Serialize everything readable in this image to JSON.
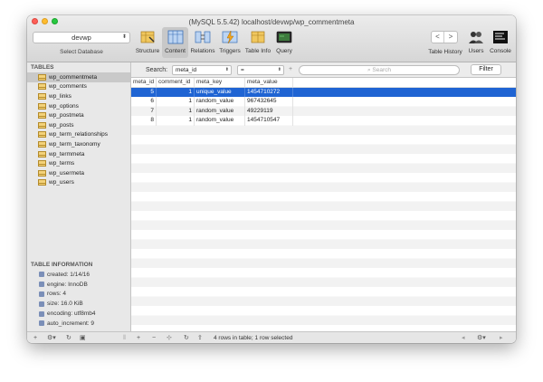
{
  "window": {
    "title": "(MySQL 5.5.42) localhost/devwp/wp_commentmeta"
  },
  "database": {
    "selected": "devwp",
    "label": "Select Database"
  },
  "toolbar": {
    "structure": "Structure",
    "content": "Content",
    "relations": "Relations",
    "triggers": "Triggers",
    "table_info": "Table Info",
    "query": "Query",
    "table_history": "Table History",
    "users": "Users",
    "console": "Console"
  },
  "nav": {
    "back": "<",
    "forward": ">"
  },
  "sidebar": {
    "tables_header": "TABLES",
    "tables": [
      "wp_commentmeta",
      "wp_comments",
      "wp_links",
      "wp_options",
      "wp_postmeta",
      "wp_posts",
      "wp_term_relationships",
      "wp_term_taxonomy",
      "wp_termmeta",
      "wp_terms",
      "wp_usermeta",
      "wp_users"
    ],
    "info_header": "TABLE INFORMATION",
    "info": [
      "created: 1/14/16",
      "engine: InnoDB",
      "rows: 4",
      "size: 16.0 KiB",
      "encoding: utf8mb4",
      "auto_increment: 9"
    ]
  },
  "search": {
    "label": "Search:",
    "field": "meta_id",
    "operator": "=",
    "plus": "+",
    "placeholder": "Search",
    "filter_label": "Filter"
  },
  "grid": {
    "columns": [
      "meta_id",
      "comment_id",
      "meta_key",
      "meta_value"
    ],
    "rows": [
      [
        "5",
        "1",
        "unique_value",
        "1454710272"
      ],
      [
        "6",
        "1",
        "random_value",
        "967432645"
      ],
      [
        "7",
        "1",
        "random_value",
        "49229119"
      ],
      [
        "8",
        "1",
        "random_value",
        "1454710547"
      ]
    ]
  },
  "status": "4 rows in table; 1 row selected",
  "colors": {
    "selection": "#1f64d3",
    "sidebar": "#e8e8e8"
  }
}
